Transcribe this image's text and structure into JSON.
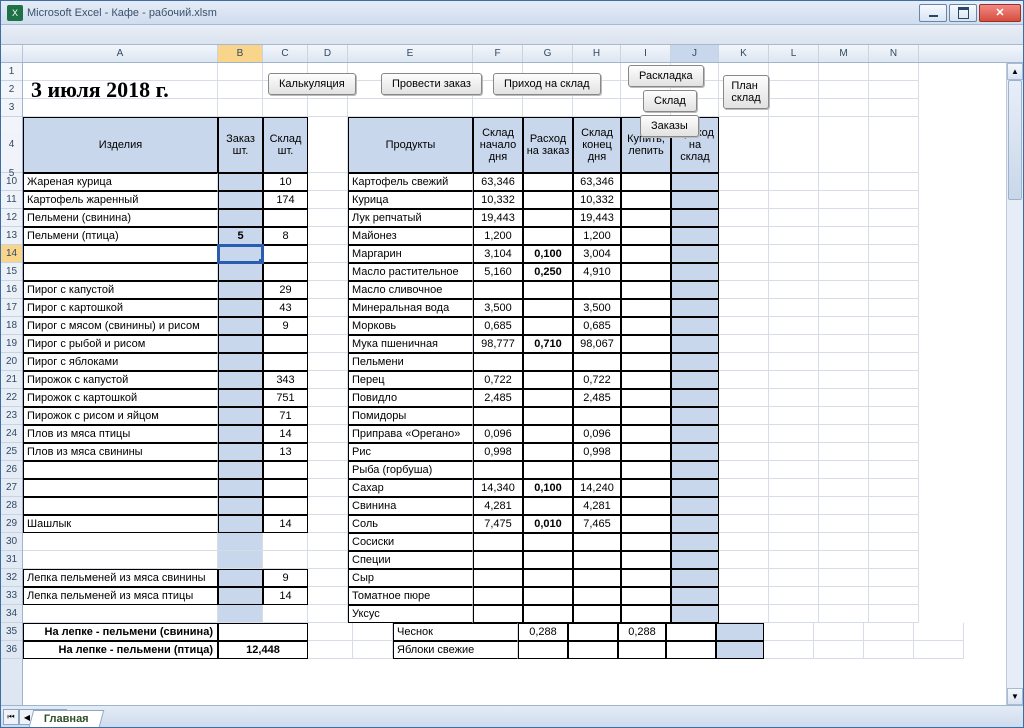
{
  "app_title": "Microsoft Excel - Кафе - рабочий.xlsm",
  "date_heading": "3 июля 2018 г.",
  "top_buttons": {
    "calc": "Калькуляция",
    "order": "Провести заказ",
    "income": "Приход на склад",
    "layout": "Раскладка",
    "sklad": "Склад",
    "orders": "Заказы",
    "plan": "План склад"
  },
  "columns": [
    "A",
    "B",
    "C",
    "D",
    "E",
    "F",
    "G",
    "H",
    "I",
    "J",
    "K",
    "L",
    "M",
    "N"
  ],
  "row_numbers_top": [
    "1",
    "2",
    "3"
  ],
  "row_numbers_rest": [
    "4",
    "5",
    "10",
    "11",
    "12",
    "13",
    "14",
    "15",
    "16",
    "17",
    "18",
    "19",
    "20",
    "21",
    "22",
    "23",
    "24",
    "25",
    "26",
    "27",
    "28",
    "29",
    "30",
    "31",
    "32",
    "33",
    "34",
    "35",
    "36"
  ],
  "left_headers": {
    "products": "Изделия",
    "order": "Заказ шт.",
    "stock": "Склад шт."
  },
  "right_headers": {
    "products": "Продукты",
    "start": "Склад начало дня",
    "consume": "Расход на заказ",
    "end": "Склад конец дня",
    "buy": "Купить, лепить",
    "income": "Приход на склад"
  },
  "left_rows": [
    {
      "name": "Жареная курица",
      "order": "",
      "stock": "10"
    },
    {
      "name": "Картофель жаренный",
      "order": "",
      "stock": "174"
    },
    {
      "name": "Пельмени (свинина)",
      "order": "",
      "stock": ""
    },
    {
      "name": "Пельмени (птица)",
      "order": "5",
      "stock": "8",
      "bold": true
    },
    {
      "name": "",
      "order": "",
      "stock": "",
      "active": true
    },
    {
      "name": "",
      "order": "",
      "stock": ""
    },
    {
      "name": "Пирог с капустой",
      "order": "",
      "stock": "29"
    },
    {
      "name": "Пирог с картошкой",
      "order": "",
      "stock": "43"
    },
    {
      "name": "Пирог с мясом (свинины) и рисом",
      "order": "",
      "stock": "9"
    },
    {
      "name": "Пирог с рыбой  и рисом",
      "order": "",
      "stock": ""
    },
    {
      "name": "Пирог с яблоками",
      "order": "",
      "stock": ""
    },
    {
      "name": "Пирожок с капустой",
      "order": "",
      "stock": "343"
    },
    {
      "name": "Пирожок с картошкой",
      "order": "",
      "stock": "751"
    },
    {
      "name": "Пирожок с рисом и яйцом",
      "order": "",
      "stock": "71"
    },
    {
      "name": "Плов из мяса птицы",
      "order": "",
      "stock": "14"
    },
    {
      "name": "Плов из мяса свинины",
      "order": "",
      "stock": "13"
    },
    {
      "name": "",
      "order": "",
      "stock": ""
    },
    {
      "name": "",
      "order": "",
      "stock": ""
    },
    {
      "name": "",
      "order": "",
      "stock": ""
    },
    {
      "name": "Шашлык",
      "order": "",
      "stock": "14"
    }
  ],
  "left_extra": [
    {
      "name": "Лепка пельменей из мяса свинины",
      "stock": "9"
    },
    {
      "name": "Лепка пельменей из мяса птицы",
      "stock": "14"
    }
  ],
  "bottom_notes": [
    {
      "label": "На лепке - пельмени (свинина)",
      "value": ""
    },
    {
      "label": "На лепке - пельмени (птица)",
      "value": "12,448"
    }
  ],
  "right_rows": [
    {
      "name": "Картофель свежий",
      "start": "63,346",
      "cons": "",
      "end": "63,346"
    },
    {
      "name": "Курица",
      "start": "10,332",
      "cons": "",
      "end": "10,332"
    },
    {
      "name": "Лук репчатый",
      "start": "19,443",
      "cons": "",
      "end": "19,443"
    },
    {
      "name": "Майонез",
      "start": "1,200",
      "cons": "",
      "end": "1,200"
    },
    {
      "name": "Маргарин",
      "start": "3,104",
      "cons": "0,100",
      "end": "3,004",
      "bold": true
    },
    {
      "name": "Масло растительное",
      "start": "5,160",
      "cons": "0,250",
      "end": "4,910",
      "bold": true
    },
    {
      "name": "Масло сливочное",
      "start": "",
      "cons": "",
      "end": ""
    },
    {
      "name": "Минеральная вода",
      "start": "3,500",
      "cons": "",
      "end": "3,500"
    },
    {
      "name": "Морковь",
      "start": "0,685",
      "cons": "",
      "end": "0,685"
    },
    {
      "name": "Мука пшеничная",
      "start": "98,777",
      "cons": "0,710",
      "end": "98,067",
      "bold": true
    },
    {
      "name": "Пельмени",
      "start": "",
      "cons": "",
      "end": ""
    },
    {
      "name": "Перец",
      "start": "0,722",
      "cons": "",
      "end": "0,722"
    },
    {
      "name": "Повидло",
      "start": "2,485",
      "cons": "",
      "end": "2,485"
    },
    {
      "name": "Помидоры",
      "start": "",
      "cons": "",
      "end": ""
    },
    {
      "name": "Приправа «Орегано»",
      "start": "0,096",
      "cons": "",
      "end": "0,096"
    },
    {
      "name": "Рис",
      "start": "0,998",
      "cons": "",
      "end": "0,998"
    },
    {
      "name": "Рыба (горбуша)",
      "start": "",
      "cons": "",
      "end": ""
    },
    {
      "name": "Сахар",
      "start": "14,340",
      "cons": "0,100",
      "end": "14,240",
      "bold": true
    },
    {
      "name": "Свинина",
      "start": "4,281",
      "cons": "",
      "end": "4,281"
    },
    {
      "name": "Соль",
      "start": "7,475",
      "cons": "0,010",
      "end": "7,465",
      "bold": true
    },
    {
      "name": "Сосиски",
      "start": "",
      "cons": "",
      "end": ""
    },
    {
      "name": "Специи",
      "start": "",
      "cons": "",
      "end": ""
    },
    {
      "name": "Сыр",
      "start": "",
      "cons": "",
      "end": ""
    },
    {
      "name": "Томатное пюре",
      "start": "",
      "cons": "",
      "end": ""
    },
    {
      "name": "Уксус",
      "start": "",
      "cons": "",
      "end": ""
    },
    {
      "name": "Чеснок",
      "start": "0,288",
      "cons": "",
      "end": "0,288"
    },
    {
      "name": "Яблоки свежие",
      "start": "",
      "cons": "",
      "end": ""
    }
  ],
  "sheet_tab": "Главная"
}
